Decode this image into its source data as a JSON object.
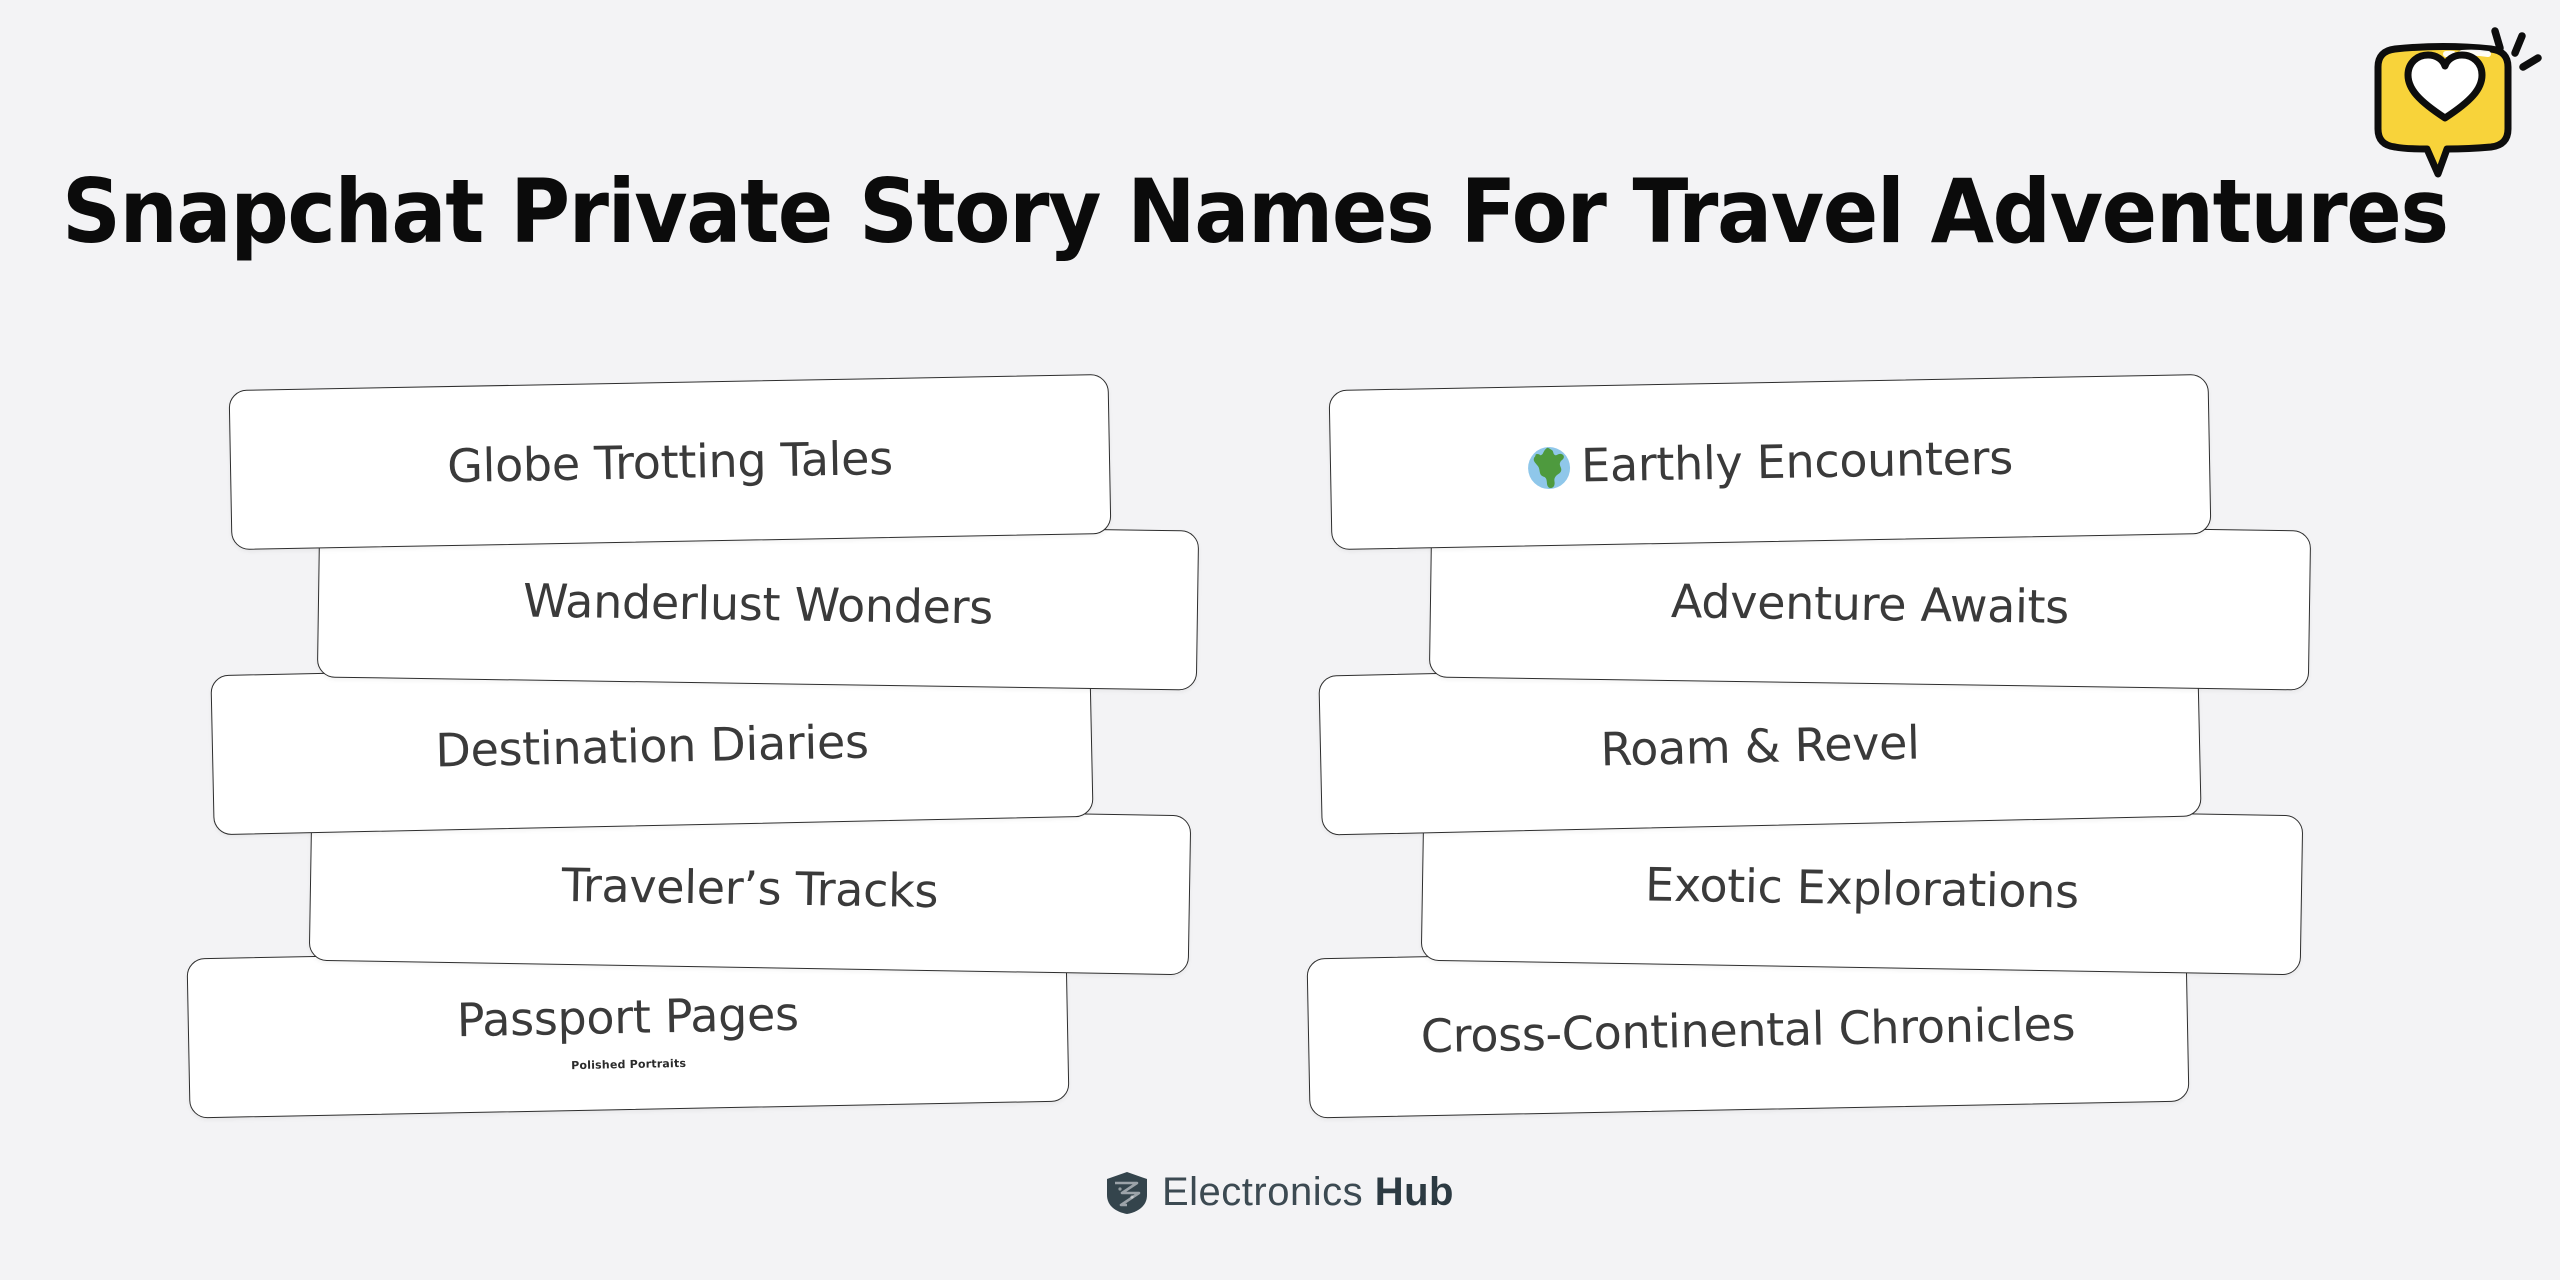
{
  "page": {
    "background_color": "#f3f3f5",
    "title": "Snapchat Private Story Names For Travel Adventures"
  },
  "sticker": {
    "name": "heart-speech-bubble-sticker",
    "bubble_color": "#F8D33A",
    "heart_color": "#ffffff",
    "outline_color": "#0d0d0d"
  },
  "columns": {
    "left": {
      "cards": [
        {
          "label": "Globe Trotting Tales",
          "sub": "",
          "emoji": ""
        },
        {
          "label": "Wanderlust Wonders",
          "sub": "",
          "emoji": ""
        },
        {
          "label": "Destination Diaries",
          "sub": "",
          "emoji": ""
        },
        {
          "label": "Traveler’s Tracks",
          "sub": "",
          "emoji": ""
        },
        {
          "label": "Passport Pages",
          "sub": "Polished Portraits",
          "emoji": ""
        }
      ]
    },
    "right": {
      "cards": [
        {
          "label": "Earthly Encounters",
          "sub": "",
          "emoji": "globe-emoji"
        },
        {
          "label": "Adventure Awaits",
          "sub": "",
          "emoji": ""
        },
        {
          "label": "Roam & Revel",
          "sub": "",
          "emoji": ""
        },
        {
          "label": "Exotic Explorations",
          "sub": "",
          "emoji": ""
        },
        {
          "label": "Cross-Continental Chronicles",
          "sub": "",
          "emoji": ""
        }
      ]
    }
  },
  "footer": {
    "brand_light": "Electronics ",
    "brand_bold": "Hub",
    "mark_color": "#34444c"
  },
  "colors": {
    "card_bg": "#ffffff",
    "card_border": "#2e2e2e",
    "card_text": "#3a3a3a",
    "title_text": "#0b0b0b"
  }
}
